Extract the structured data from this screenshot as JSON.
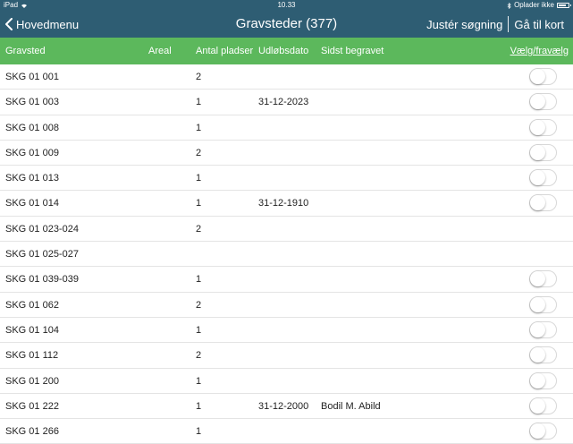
{
  "status": {
    "device": "iPad",
    "time": "10.33",
    "charging": "Oplader ikke"
  },
  "nav": {
    "back_label": "Hovedmenu",
    "title": "Gravsteder (377)",
    "adjust_label": "Justér søgning",
    "map_label": "Gå til kort"
  },
  "columns": {
    "gravsted": "Gravsted",
    "areal": "Areal",
    "antal": "Antal pladser",
    "udlob": "Udløbsdato",
    "sidst": "Sidst begravet",
    "select": "Vælg/fravælg"
  },
  "rows": [
    {
      "name": "SKG 01  001",
      "places": "2",
      "date": "",
      "buried": "",
      "toggle": true
    },
    {
      "name": "SKG 01  003",
      "places": "1",
      "date": "31-12-2023",
      "buried": "",
      "toggle": true
    },
    {
      "name": "SKG 01  008",
      "places": "1",
      "date": "",
      "buried": "",
      "toggle": true
    },
    {
      "name": "SKG 01  009",
      "places": "2",
      "date": "",
      "buried": "",
      "toggle": true
    },
    {
      "name": "SKG 01  013",
      "places": "1",
      "date": "",
      "buried": "",
      "toggle": true
    },
    {
      "name": "SKG 01  014",
      "places": "1",
      "date": "31-12-1910",
      "buried": "",
      "toggle": true
    },
    {
      "name": "SKG 01  023-024",
      "places": "2",
      "date": "",
      "buried": "",
      "toggle": false
    },
    {
      "name": "SKG 01  025-027",
      "places": "",
      "date": "",
      "buried": "",
      "toggle": false
    },
    {
      "name": "SKG 01  039-039",
      "places": "1",
      "date": "",
      "buried": "",
      "toggle": true
    },
    {
      "name": "SKG 01  062",
      "places": "2",
      "date": "",
      "buried": "",
      "toggle": true
    },
    {
      "name": "SKG 01  104",
      "places": "1",
      "date": "",
      "buried": "",
      "toggle": true
    },
    {
      "name": "SKG 01  112",
      "places": "2",
      "date": "",
      "buried": "",
      "toggle": true
    },
    {
      "name": "SKG 01  200",
      "places": "1",
      "date": "",
      "buried": "",
      "toggle": true
    },
    {
      "name": "SKG 01  222",
      "places": "1",
      "date": "31-12-2000",
      "buried": "Bodil M. Abild",
      "toggle": true
    },
    {
      "name": "SKG 01  266",
      "places": "1",
      "date": "",
      "buried": "",
      "toggle": true
    }
  ]
}
